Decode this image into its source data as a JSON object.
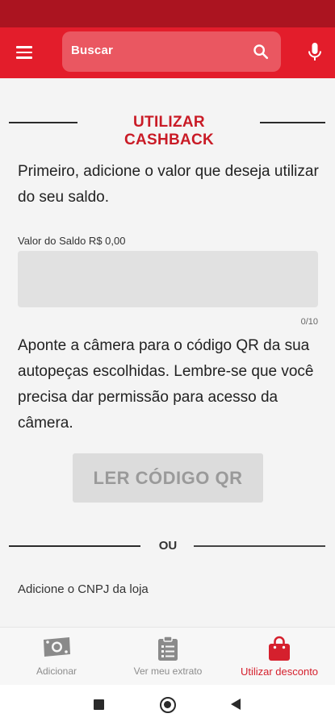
{
  "header": {
    "search_placeholder": "Buscar",
    "icons": [
      "menu-icon",
      "search-icon",
      "mic-icon"
    ]
  },
  "main": {
    "section_title": "UTILIZAR CASHBACK",
    "intro_text": "Primeiro, adicione o valor que deseja utilizar do seu saldo.",
    "saldo_label": "Valor do Saldo R$ 0,00",
    "saldo_value": "",
    "saldo_counter": "0/10",
    "camera_text": "Aponte a câmera para o código QR da sua autopeças escolhidas. Lembre-se que você precisa dar permissão para acesso da câmera.",
    "qr_button_label": "LER CÓDIGO QR",
    "or_label": "OU",
    "cnpj_label": "Adicione o CNPJ da loja"
  },
  "bottom_nav": {
    "items": [
      {
        "label": "Adicionar",
        "icon": "money-icon",
        "active": false
      },
      {
        "label": "Ver meu extrato",
        "icon": "clipboard-icon",
        "active": false
      },
      {
        "label": "Utilizar desconto",
        "icon": "shopping-bag-icon",
        "active": true
      }
    ]
  },
  "colors": {
    "status_bar": "#ab1420",
    "app_bar": "#e31d2b",
    "accent": "#c91b26",
    "active_nav": "#d5202d"
  }
}
